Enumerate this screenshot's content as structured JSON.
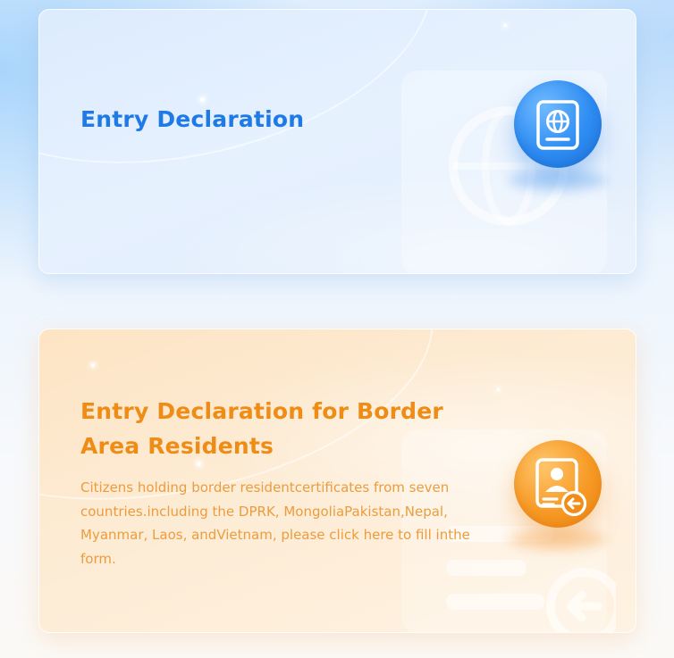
{
  "cards": [
    {
      "title": "Entry Declaration",
      "icon": "passport-globe-icon",
      "accent": "#1f7ae6"
    },
    {
      "title": "Entry Declaration for Border Area Residents",
      "description": "Citizens holding border residentcertificates from seven countries.including the DPRK, MongoliaPakistan,Nepal, Myanmar, Laos, andVietnam, please click here to fill inthe form.",
      "icon": "resident-id-card-icon",
      "accent": "#ef8c15"
    }
  ]
}
